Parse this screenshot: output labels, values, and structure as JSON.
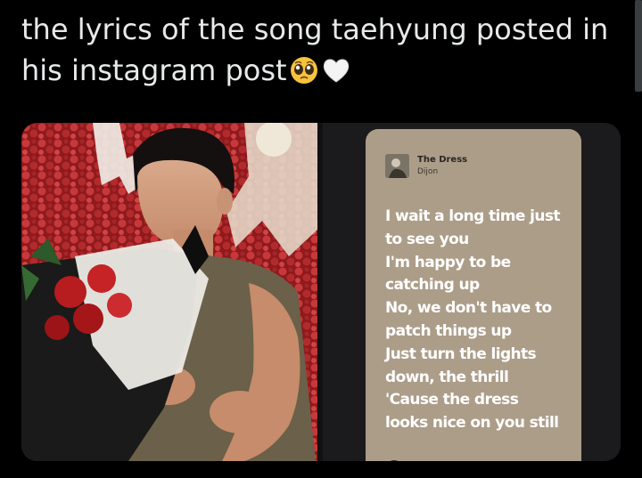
{
  "tweet": {
    "text": "the lyrics of the song taehyung posted in his instagram post",
    "emojis": [
      "pleading-face-emoji",
      "white-heart-emoji"
    ]
  },
  "media": {
    "right": {
      "song_title": "The Dress",
      "song_artist": "Dijon",
      "lyrics_lines": [
        "I wait a long time just",
        "to see you",
        "I'm happy to be",
        "catching up",
        "No, we don't have to",
        "patch things up",
        "Just turn the lights",
        "down, the thrill",
        "'Cause the dress",
        "looks nice on you still"
      ],
      "card_color": "#ac9d89"
    }
  }
}
